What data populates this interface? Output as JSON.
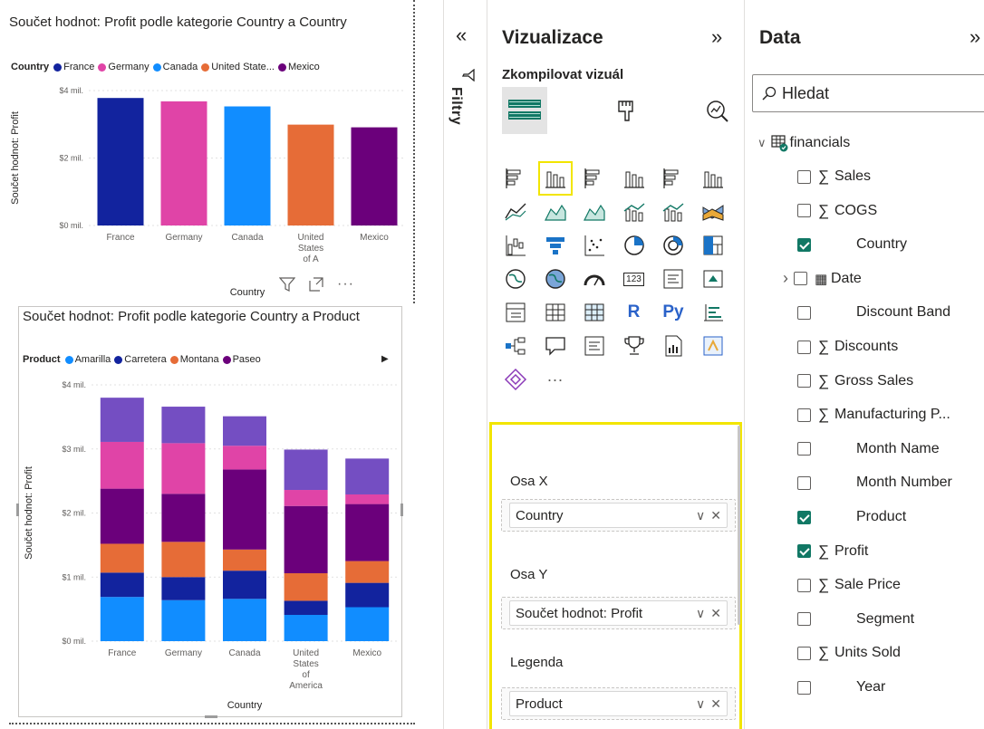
{
  "chart1": {
    "title": "Součet hodnot: Profit podle kategorie Country a Country",
    "legend_title": "Country",
    "ylabel": "Součet hodnot: Profit",
    "xlabel": "Country"
  },
  "chart2": {
    "title": "Součet hodnot: Profit podle kategorie Country a Product",
    "legend_title": "Product",
    "ylabel": "Součet hodnot: Profit",
    "xlabel": "Country"
  },
  "chart_data": [
    {
      "type": "bar",
      "title": "Součet hodnot: Profit podle kategorie Country a Country",
      "ylabel": "Součet hodnot: Profit",
      "xlabel": "Country",
      "categories": [
        "France",
        "Germany",
        "Canada",
        "United States of A",
        "Mexico"
      ],
      "series": [
        {
          "name": "France",
          "color": "#12239e",
          "values": [
            3.78,
            null,
            null,
            null,
            null
          ]
        },
        {
          "name": "Germany",
          "color": "#e044a7",
          "values": [
            null,
            3.68,
            null,
            null,
            null
          ]
        },
        {
          "name": "Canada",
          "color": "#118dff",
          "values": [
            null,
            null,
            3.53,
            null,
            null
          ]
        },
        {
          "name": "United State...",
          "color": "#e66c37",
          "values": [
            null,
            null,
            null,
            2.99,
            null
          ]
        },
        {
          "name": "Mexico",
          "color": "#6b007b",
          "values": [
            null,
            null,
            null,
            null,
            2.91
          ]
        }
      ],
      "yticks": [
        "$0 mil.",
        "$2 mil.",
        "$4 mil."
      ],
      "ylim": [
        0,
        4
      ],
      "legend_position": "top-left",
      "grid": true
    },
    {
      "type": "bar",
      "stacked": true,
      "title": "Součet hodnot: Profit podle kategorie Country a Product",
      "ylabel": "Součet hodnot: Profit",
      "xlabel": "Country",
      "categories": [
        "France",
        "Germany",
        "Canada",
        "United States of America",
        "Mexico"
      ],
      "series": [
        {
          "name": "Amarilla",
          "color": "#118dff",
          "values": [
            0.69,
            0.64,
            0.66,
            0.41,
            0.53
          ]
        },
        {
          "name": "Carretera",
          "color": "#12239e",
          "values": [
            0.38,
            0.36,
            0.44,
            0.22,
            0.38
          ]
        },
        {
          "name": "Montana",
          "color": "#e66c37",
          "values": [
            0.45,
            0.55,
            0.33,
            0.43,
            0.34
          ]
        },
        {
          "name": "Paseo",
          "color": "#6b007b",
          "values": [
            0.86,
            0.75,
            1.25,
            1.05,
            0.89
          ]
        },
        {
          "name": "",
          "color": "#e044a7",
          "values": [
            0.73,
            0.79,
            0.37,
            0.25,
            0.15
          ]
        },
        {
          "name": "",
          "color": "#744ec2",
          "values": [
            0.69,
            0.57,
            0.46,
            0.63,
            0.56
          ]
        }
      ],
      "yticks": [
        "$0 mil.",
        "$1 mil.",
        "$2 mil.",
        "$3 mil.",
        "$4 mil."
      ],
      "ylim": [
        0,
        4
      ],
      "legend_position": "top-left",
      "grid": true
    }
  ],
  "filters": {
    "label": "Filtry",
    "collapse_glyph": "«"
  },
  "viz": {
    "title": "Vizualizace",
    "expand_glyph": "»",
    "build_label": "Zkompilovat vizuál",
    "wells": [
      {
        "label": "Osa X",
        "field": "Country"
      },
      {
        "label": "Osa Y",
        "field": "Součet hodnot: Profit"
      },
      {
        "label": "Legenda",
        "field": "Product"
      }
    ],
    "icons": [
      "stacked-bar-chart",
      "stacked-column-chart",
      "clustered-bar-chart",
      "clustered-column-chart",
      "100-stacked-bar-chart",
      "100-stacked-column-chart",
      "line-chart",
      "area-chart",
      "stacked-area-chart",
      "line-and-stacked-column-chart",
      "line-and-clustered-column-chart",
      "ribbon-chart",
      "waterfall-chart",
      "funnel-chart",
      "scatter-chart",
      "pie-chart",
      "donut-chart",
      "treemap",
      "map",
      "filled-map",
      "gauge",
      "card",
      "multi-row-card",
      "kpi",
      "slicer",
      "table",
      "matrix",
      "r-visual",
      "python-visual",
      "key-influencers",
      "decomposition-tree",
      "qa-visual",
      "narrative",
      "metrics",
      "paginated-report",
      "power-apps",
      "power-automate",
      "more-visuals"
    ],
    "icon_texts": {
      "r-visual": "R",
      "python-visual": "Py",
      "card": "123",
      "more-visuals": "···"
    }
  },
  "data_pane": {
    "title": "Data",
    "collapse_glyph": "»",
    "search_placeholder": "Hledat",
    "table_name": "financials",
    "fields": [
      {
        "name": "Sales",
        "sigma": true,
        "checked": false
      },
      {
        "name": "COGS",
        "sigma": true,
        "checked": false
      },
      {
        "name": "Country",
        "sigma": false,
        "checked": true
      },
      {
        "name": "Date",
        "sigma": false,
        "checked": false,
        "date": true
      },
      {
        "name": "Discount Band",
        "sigma": false,
        "checked": false
      },
      {
        "name": "Discounts",
        "sigma": true,
        "checked": false
      },
      {
        "name": "Gross Sales",
        "sigma": true,
        "checked": false
      },
      {
        "name": "Manufacturing P...",
        "sigma": true,
        "checked": false
      },
      {
        "name": "Month Name",
        "sigma": false,
        "checked": false
      },
      {
        "name": "Month Number",
        "sigma": false,
        "checked": false
      },
      {
        "name": "Product",
        "sigma": false,
        "checked": true
      },
      {
        "name": "Profit",
        "sigma": true,
        "checked": true
      },
      {
        "name": "Sale Price",
        "sigma": true,
        "checked": false
      },
      {
        "name": "Segment",
        "sigma": false,
        "checked": false
      },
      {
        "name": "Units Sold",
        "sigma": true,
        "checked": false
      },
      {
        "name": "Year",
        "sigma": false,
        "checked": false
      }
    ]
  },
  "colors": {
    "accent_highlight": "#f2e500",
    "check_green": "#117865"
  }
}
